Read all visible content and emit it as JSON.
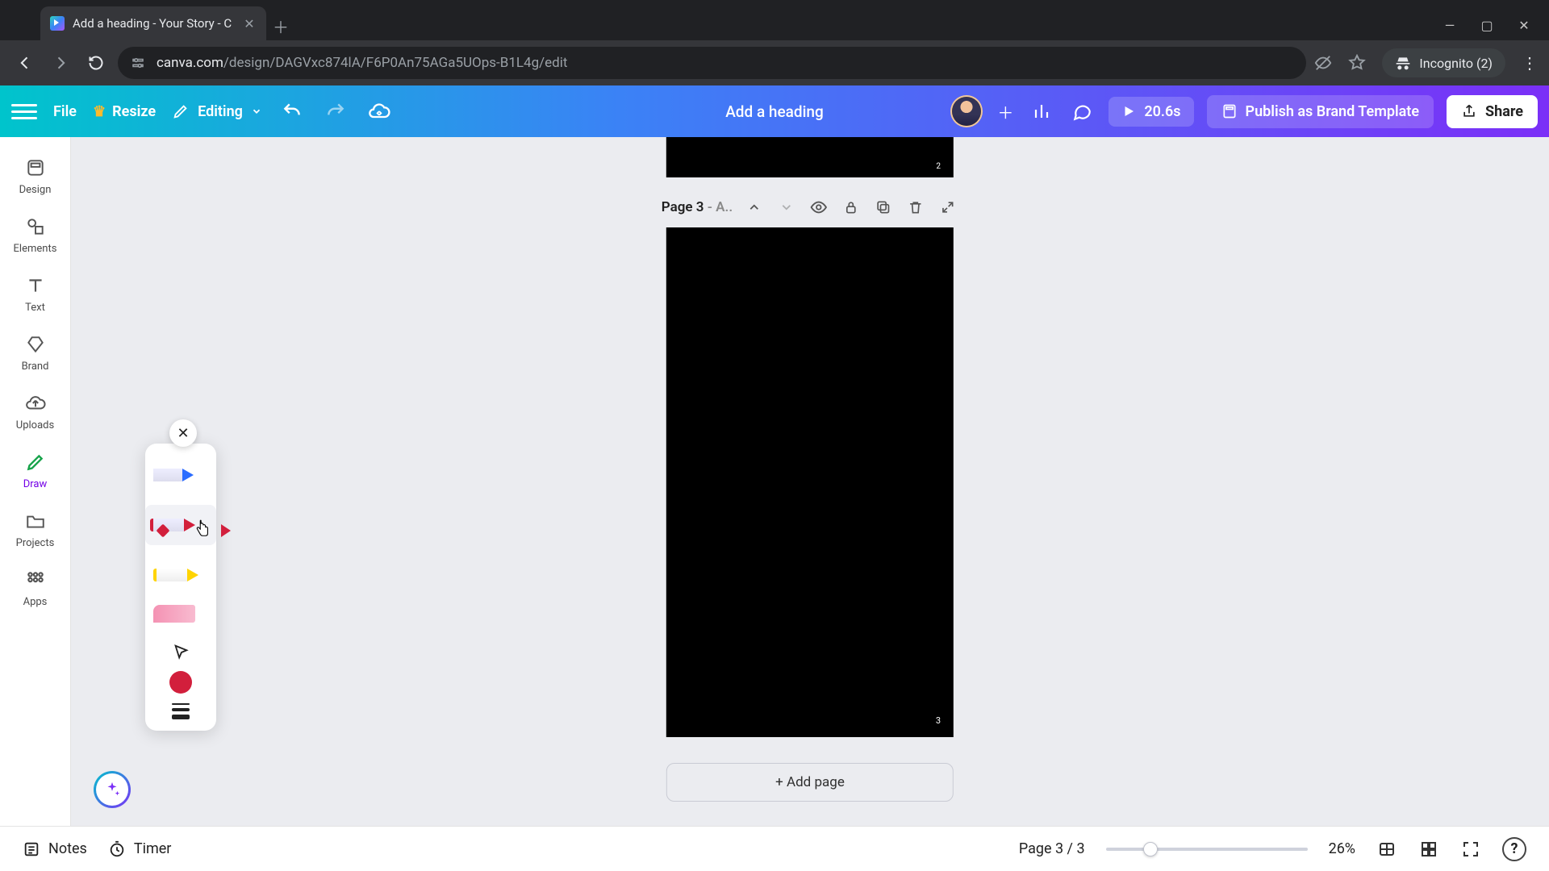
{
  "browser": {
    "tab_title": "Add a heading - Your Story - C",
    "url_host": "canva.com",
    "url_path": "/design/DAGVxc874lA/F6P0An75AGa5UOps-B1L4g/edit",
    "incognito_label": "Incognito (2)"
  },
  "toolbar": {
    "file": "File",
    "resize": "Resize",
    "editing": "Editing",
    "doc_title": "Add a heading",
    "duration": "20.6s",
    "publish": "Publish as Brand Template",
    "share": "Share"
  },
  "rail": {
    "design": "Design",
    "elements": "Elements",
    "text": "Text",
    "brand": "Brand",
    "uploads": "Uploads",
    "draw": "Draw",
    "projects": "Projects",
    "apps": "Apps"
  },
  "draw_panel": {
    "pen_blue": "pen-blue",
    "pen_red": "pen-red",
    "pen_yellow": "highlighter-yellow",
    "eraser": "eraser-pink",
    "cursor": "select",
    "color_hex": "#d21f3c",
    "weight": "stroke-weight"
  },
  "page": {
    "prev_page_number": "2",
    "label_prefix": "Page 3",
    "label_suffix": " - A..",
    "page_number": "3",
    "add_page": "+ Add page"
  },
  "footer": {
    "notes": "Notes",
    "timer": "Timer",
    "page_counter": "Page 3 / 3",
    "zoom": "26%"
  }
}
